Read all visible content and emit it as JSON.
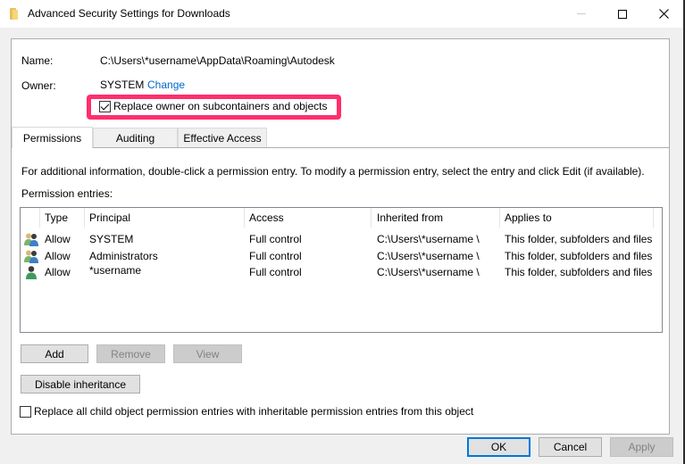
{
  "window": {
    "title": "Advanced Security Settings for Downloads",
    "folder_icon": "folder-icon",
    "controls": {
      "minimize": "minimize-icon",
      "maximize": "maximize-icon",
      "close": "close-icon"
    }
  },
  "header": {
    "name_label": "Name:",
    "name_value": "C:\\Users\\*username\\AppData\\Roaming\\Autodesk",
    "owner_label": "Owner:",
    "owner_value": "SYSTEM",
    "change_link": "Change",
    "replace_owner_label": "Replace owner on subcontainers and objects",
    "replace_owner_checked": true,
    "highlight_color": "#ff2e6d"
  },
  "tabs": [
    {
      "label": "Permissions",
      "active": true
    },
    {
      "label": "Auditing",
      "active": false
    },
    {
      "label": "Effective Access",
      "active": false
    }
  ],
  "permissions": {
    "info_text": "For additional information, double-click a permission entry. To modify a permission entry, select the entry and click Edit (if available).",
    "entries_label": "Permission entries:",
    "columns": [
      "Type",
      "Principal",
      "Access",
      "Inherited from",
      "Applies to"
    ],
    "rows": [
      {
        "icon": "group-icon",
        "type": "Allow",
        "principal": "SYSTEM",
        "access": "Full control",
        "inherited_from": "C:\\Users\\*username \\",
        "applies_to": "This folder, subfolders and files"
      },
      {
        "icon": "group-icon",
        "type": "Allow",
        "principal": "Administrators",
        "access": "Full control",
        "inherited_from": "C:\\Users\\*username \\",
        "applies_to": "This folder, subfolders and files"
      },
      {
        "icon": "user-icon",
        "type": "Allow",
        "principal": "*username",
        "access": "Full control",
        "inherited_from": "C:\\Users\\*username \\",
        "applies_to": "This folder, subfolders and files"
      }
    ],
    "buttons": {
      "add": "Add",
      "remove": "Remove",
      "view": "View"
    },
    "disable_inheritance": "Disable inheritance",
    "replace_child_label": "Replace all child object permission entries with inheritable permission entries from this object",
    "replace_child_checked": false
  },
  "footer": {
    "ok": "OK",
    "cancel": "Cancel",
    "apply": "Apply"
  }
}
